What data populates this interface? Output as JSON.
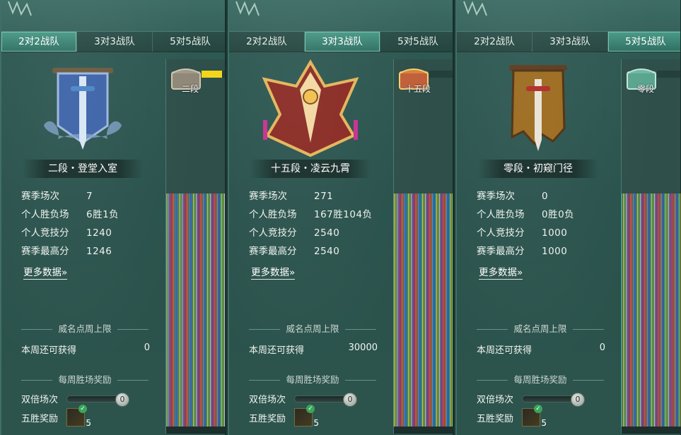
{
  "panels": [
    {
      "tabs": [
        "2对2战队",
        "3对3战队",
        "5对5战队"
      ],
      "active_tab": 0,
      "emblem_icon": "blue-banner-sword-emblem-icon",
      "rank_title": "二段・登堂入室",
      "stats": [
        {
          "label": "赛季场次",
          "value": "7"
        },
        {
          "label": "个人胜负场",
          "value": "6胜1负"
        },
        {
          "label": "个人竞技分",
          "value": "1240"
        },
        {
          "label": "赛季最高分",
          "value": "1246"
        }
      ],
      "more_link": "更多数据»",
      "section_weekly_cap": "威名点周上限",
      "week_label": "本周还可获得",
      "week_value": "0",
      "section_weekly_reward": "每周胜场奖励",
      "double_label": "双倍场次",
      "double_value": "0",
      "five_win_label": "五胜奖励",
      "five_win_count": "5",
      "side_rank_label": "二段",
      "side_progress": 0.75,
      "side_color": "#f3d51c"
    },
    {
      "tabs": [
        "2对2战队",
        "3对3战队",
        "5对5战队"
      ],
      "active_tab": 1,
      "emblem_icon": "golden-winged-shield-emblem-icon",
      "rank_title": "十五段・凌云九霄",
      "stats": [
        {
          "label": "赛季场次",
          "value": "271"
        },
        {
          "label": "个人胜负场",
          "value": "167胜104负"
        },
        {
          "label": "个人竞技分",
          "value": "2540"
        },
        {
          "label": "赛季最高分",
          "value": "2540"
        }
      ],
      "more_link": "更多数据»",
      "section_weekly_cap": "威名点周上限",
      "week_label": "本周还可获得",
      "week_value": "30000",
      "section_weekly_reward": "每周胜场奖励",
      "double_label": "双倍场次",
      "double_value": "0",
      "five_win_label": "五胜奖励",
      "five_win_count": "5",
      "side_rank_label": "十五段",
      "side_progress": 0.0,
      "side_color": "#f3d51c"
    },
    {
      "tabs": [
        "2对2战队",
        "3对3战队",
        "5对5战队"
      ],
      "active_tab": 2,
      "emblem_icon": "brown-banner-sword-emblem-icon",
      "rank_title": "零段・初窥门径",
      "stats": [
        {
          "label": "赛季场次",
          "value": "0"
        },
        {
          "label": "个人胜负场",
          "value": "0胜0负"
        },
        {
          "label": "个人竞技分",
          "value": "1000"
        },
        {
          "label": "赛季最高分",
          "value": "1000"
        }
      ],
      "more_link": "更多数据»",
      "section_weekly_cap": "威名点周上限",
      "week_label": "本周还可获得",
      "week_value": "0",
      "section_weekly_reward": "每周胜场奖励",
      "double_label": "双倍场次",
      "double_value": "0",
      "five_win_label": "五胜奖励",
      "five_win_count": "5",
      "side_rank_label": "零段",
      "side_progress": 0.0,
      "side_color": "#f3d51c"
    }
  ]
}
